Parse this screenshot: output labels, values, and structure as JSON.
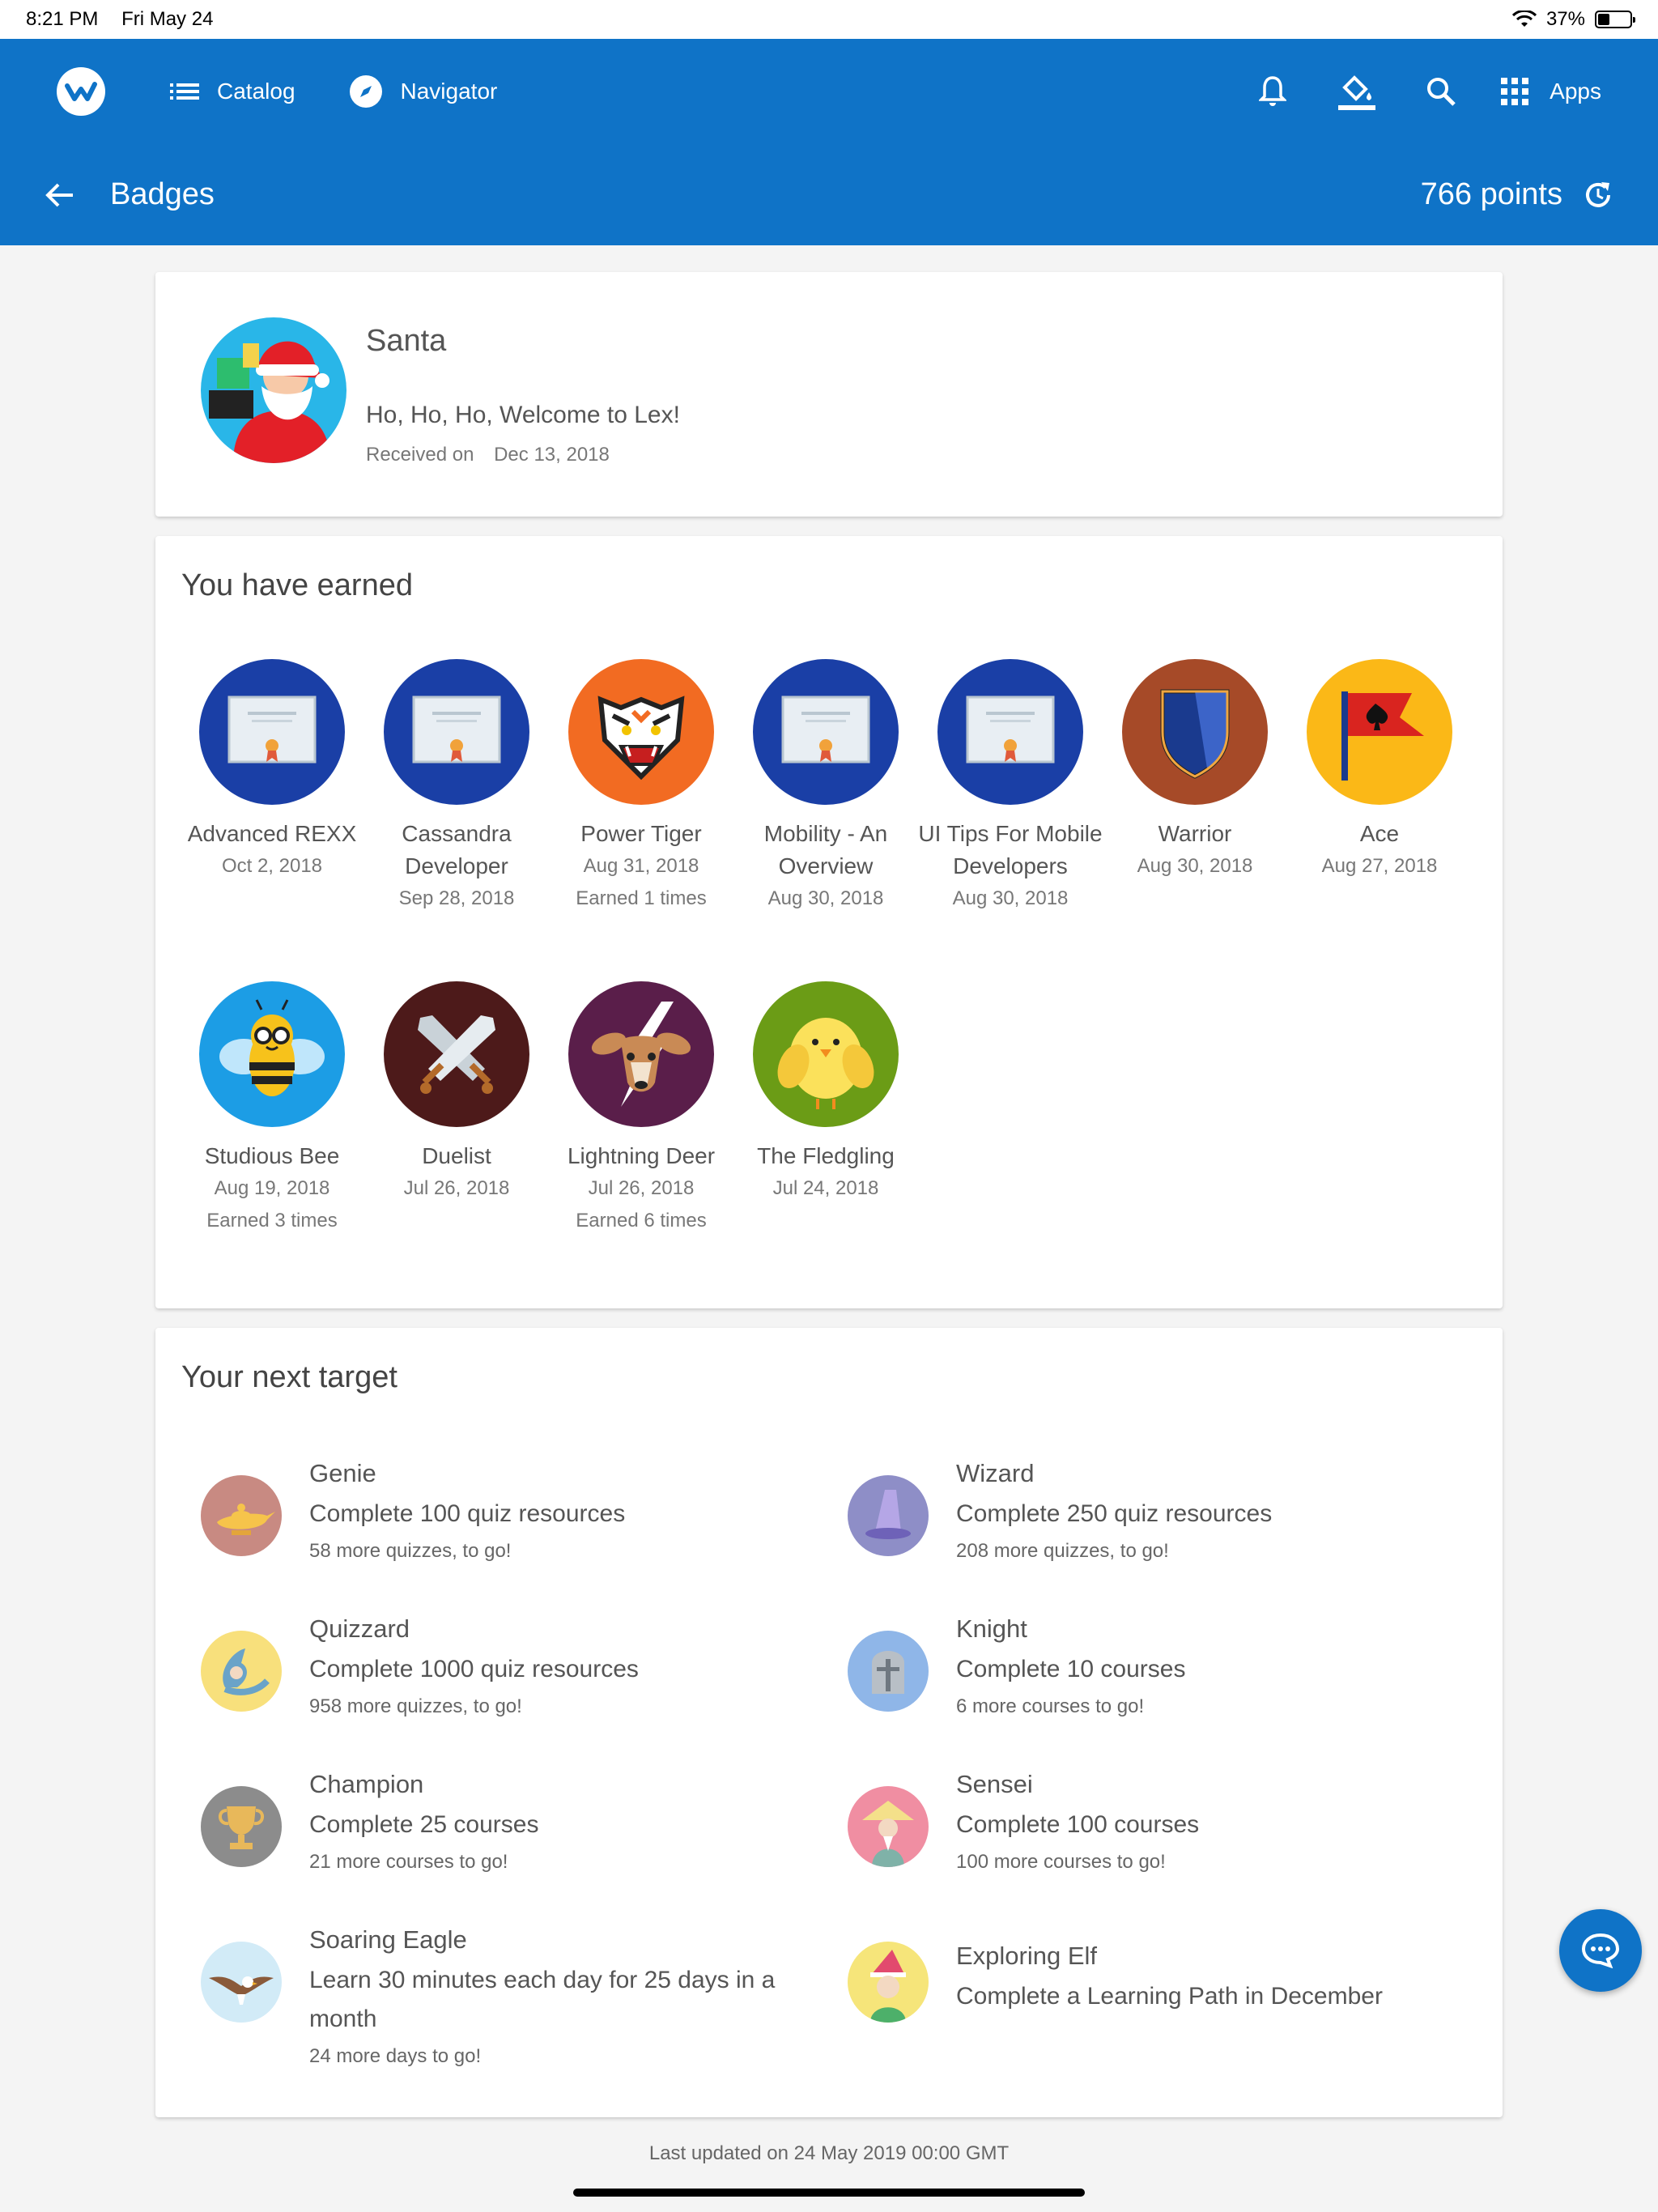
{
  "status": {
    "time": "8:21 PM",
    "date": "Fri May 24",
    "battery": "37%"
  },
  "appbar": {
    "nav": [
      {
        "label": "Catalog"
      },
      {
        "label": "Navigator"
      }
    ],
    "apps_label": "Apps",
    "page_title": "Badges",
    "points": "766 points"
  },
  "santa": {
    "name": "Santa",
    "message": "Ho, Ho, Ho, Welcome to Lex!",
    "received_label": "Received on",
    "received_date": "Dec 13, 2018"
  },
  "earned": {
    "heading": "You have earned",
    "badges": [
      {
        "name": "Advanced REXX",
        "date": "Oct 2, 2018",
        "extra": ""
      },
      {
        "name": "Cassandra Developer",
        "date": "Sep 28, 2018",
        "extra": ""
      },
      {
        "name": "Power Tiger",
        "date": "Aug 31, 2018",
        "extra": "Earned 1 times"
      },
      {
        "name": "Mobility - An Overview",
        "date": "Aug 30, 2018",
        "extra": ""
      },
      {
        "name": "UI Tips For Mobile Developers",
        "date": "Aug 30, 2018",
        "extra": ""
      },
      {
        "name": "Warrior",
        "date": "Aug 30, 2018",
        "extra": ""
      },
      {
        "name": "Ace",
        "date": "Aug 27, 2018",
        "extra": ""
      },
      {
        "name": "Studious Bee",
        "date": "Aug 19, 2018",
        "extra": "Earned 3 times"
      },
      {
        "name": "Duelist",
        "date": "Jul 26, 2018",
        "extra": ""
      },
      {
        "name": "Lightning Deer",
        "date": "Jul 26, 2018",
        "extra": "Earned 6 times"
      },
      {
        "name": "The Fledgling",
        "date": "Jul 24, 2018",
        "extra": ""
      }
    ]
  },
  "target": {
    "heading": "Your next target",
    "items": [
      {
        "name": "Genie",
        "desc": "Complete 100 quiz resources",
        "left": "58 more quizzes, to go!"
      },
      {
        "name": "Wizard",
        "desc": "Complete 250 quiz resources",
        "left": "208 more quizzes, to go!"
      },
      {
        "name": "Quizzard",
        "desc": "Complete 1000 quiz resources",
        "left": "958 more quizzes, to go!"
      },
      {
        "name": "Knight",
        "desc": "Complete 10 courses",
        "left": "6 more courses to go!"
      },
      {
        "name": "Champion",
        "desc": "Complete 25 courses",
        "left": "21 more courses to go!"
      },
      {
        "name": "Sensei",
        "desc": "Complete 100 courses",
        "left": "100 more courses to go!"
      },
      {
        "name": "Soaring Eagle",
        "desc": "Learn 30 minutes each day for 25 days in a month",
        "left": "24 more days to go!"
      },
      {
        "name": "Exploring Elf",
        "desc": "Complete a Learning Path in December",
        "left": ""
      }
    ]
  },
  "footer": "Last updated on 24 May 2019 00:00 GMT",
  "colors": {
    "primary": "#0f73c7",
    "background": "#f4f4f4"
  }
}
